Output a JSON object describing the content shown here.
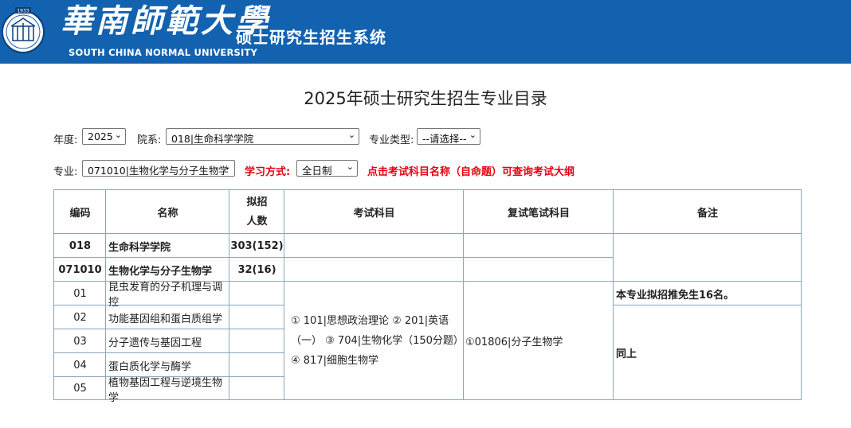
{
  "header": {
    "university_cn": "華南師範大學",
    "university_en": "SOUTH CHINA NORMAL UNIVERSITY",
    "system_name": "硕士研究生招生系统",
    "emblem_year": "1933"
  },
  "page_title": "2025年硕士研究生招生专业目录",
  "filters": {
    "year_label": "年度:",
    "year_value": "2025",
    "dept_label": "院系:",
    "dept_value": "018|生命科学学院",
    "type_label": "专业类型:",
    "type_value": "--请选择--",
    "major_label": "专业:",
    "major_value": "071010|生物化学与分子生物学",
    "mode_label": "学习方式:",
    "mode_value": "全日制",
    "hint": "点击考试科目名称（自命题）可查询考试大纲"
  },
  "table": {
    "headers": {
      "code": "编码",
      "name": "名称",
      "quota_line1": "拟招",
      "quota_line2": "人数",
      "exam": "考试科目",
      "retest": "复试笔试科目",
      "remark": "备注"
    },
    "college_row": {
      "code": "018",
      "name": "生命科学学院",
      "quota": "303(152)"
    },
    "major_row": {
      "code": "071010",
      "name": "生物化学与分子生物学",
      "quota": "32(16)"
    },
    "directions": [
      {
        "code": "01",
        "name": "昆虫发育的分子机理与调控"
      },
      {
        "code": "02",
        "name": "功能基因组和蛋白质组学"
      },
      {
        "code": "03",
        "name": "分子遗传与基因工程"
      },
      {
        "code": "04",
        "name": "蛋白质化学与酶学"
      },
      {
        "code": "05",
        "name": "植物基因工程与逆境生物学"
      }
    ],
    "exam_line1": "① 101|思想政治理论 ② 201|英语",
    "exam_line2": "（一） ③ 704|生物化学（150分题）",
    "exam_line3": "④ 817|细胞生物学",
    "retest_subject": "①01806|分子生物学",
    "remark_first": "本专业拟招推免生16名。",
    "remark_rest": "同上"
  },
  "colors": {
    "banner": "#1262b0",
    "grid": "#88a6bd",
    "hint_red": "#e60012"
  }
}
